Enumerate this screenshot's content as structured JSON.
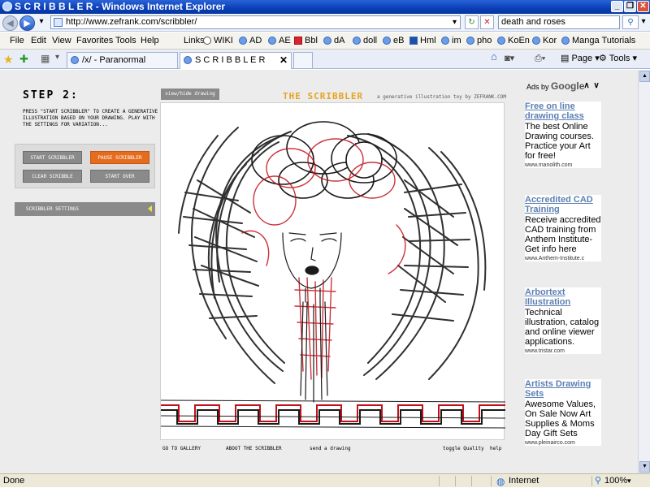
{
  "window": {
    "title": "S C R I B B L E R - Windows Internet Explorer"
  },
  "address": {
    "url": "http://www.zefrank.com/scribbler/",
    "search_value": "death and roses"
  },
  "menu": {
    "items": [
      "File",
      "Edit",
      "View",
      "Favorites",
      "Tools",
      "Help"
    ]
  },
  "links": {
    "label": "Links",
    "items": [
      "WIKI",
      "AD",
      "AE",
      "Bbl",
      "dA",
      "doll",
      "eB",
      "Hml",
      "im",
      "pho",
      "KoEn",
      "Kor",
      "Manga Tutorials"
    ]
  },
  "tabs": [
    {
      "label": "/x/ - Paranormal"
    },
    {
      "label": "S C R I B B L E R"
    }
  ],
  "toolbar": {
    "page_label": "Page",
    "tools_label": "Tools"
  },
  "scribbler": {
    "step_heading": "STEP 2:",
    "instructions": "PRESS \"START SCRIBBLER\" TO CREATE A GENERATIVE ILLUSTRATION BASED ON YOUR DRAWING. PLAY WITH THE SETTINGS FOR VARIATION...",
    "buttons": {
      "start": "START SCRIBBLER",
      "pause": "PAUSE SCRIBBLER",
      "clear": "CLEAR SCRIBBLE",
      "start_over": "START OVER"
    },
    "settings_label": "SCRIBBLER SETTINGS",
    "view_hide_label": "view/hide drawing",
    "title": "THE SCRIBBLER",
    "subtitle": "a generative illustration toy by ZEFRANK.COM",
    "footer": {
      "gallery": "GO TO GALLERY",
      "about": "ABOUT THE SCRIBBLER",
      "send": "send a drawing",
      "toggle_quality": "toggle Quality",
      "help": "help"
    },
    "ink_colors": {
      "black": "#1a1a1a",
      "red": "#c0101a"
    },
    "accent_color": "#e7a31e",
    "pause_color": "#e46c1e"
  },
  "ads": {
    "header_prefix": "Ads by",
    "header_brand": "Google",
    "items": [
      {
        "title": "Free on line drawing class",
        "body": "The best Online Drawing courses. Practice your Art for free!",
        "url": "www.manolith.com"
      },
      {
        "title": "Accredited CAD Training",
        "body": "Receive accredited CAD training from Anthem Institute-Get info here",
        "url": "www.Anthem-Institute.c"
      },
      {
        "title": "Arbortext Illustration",
        "body": "Technical illustration, catalog and online viewer applications.",
        "url": "www.tristar.com"
      },
      {
        "title": "Artists Drawing Sets",
        "body": "Awesome Values, On Sale Now Art Supplies & Moms Day Gift Sets",
        "url": "www.pleinairco.com"
      }
    ]
  },
  "status": {
    "left": "Done",
    "zone": "Internet",
    "zoom": "100%"
  }
}
